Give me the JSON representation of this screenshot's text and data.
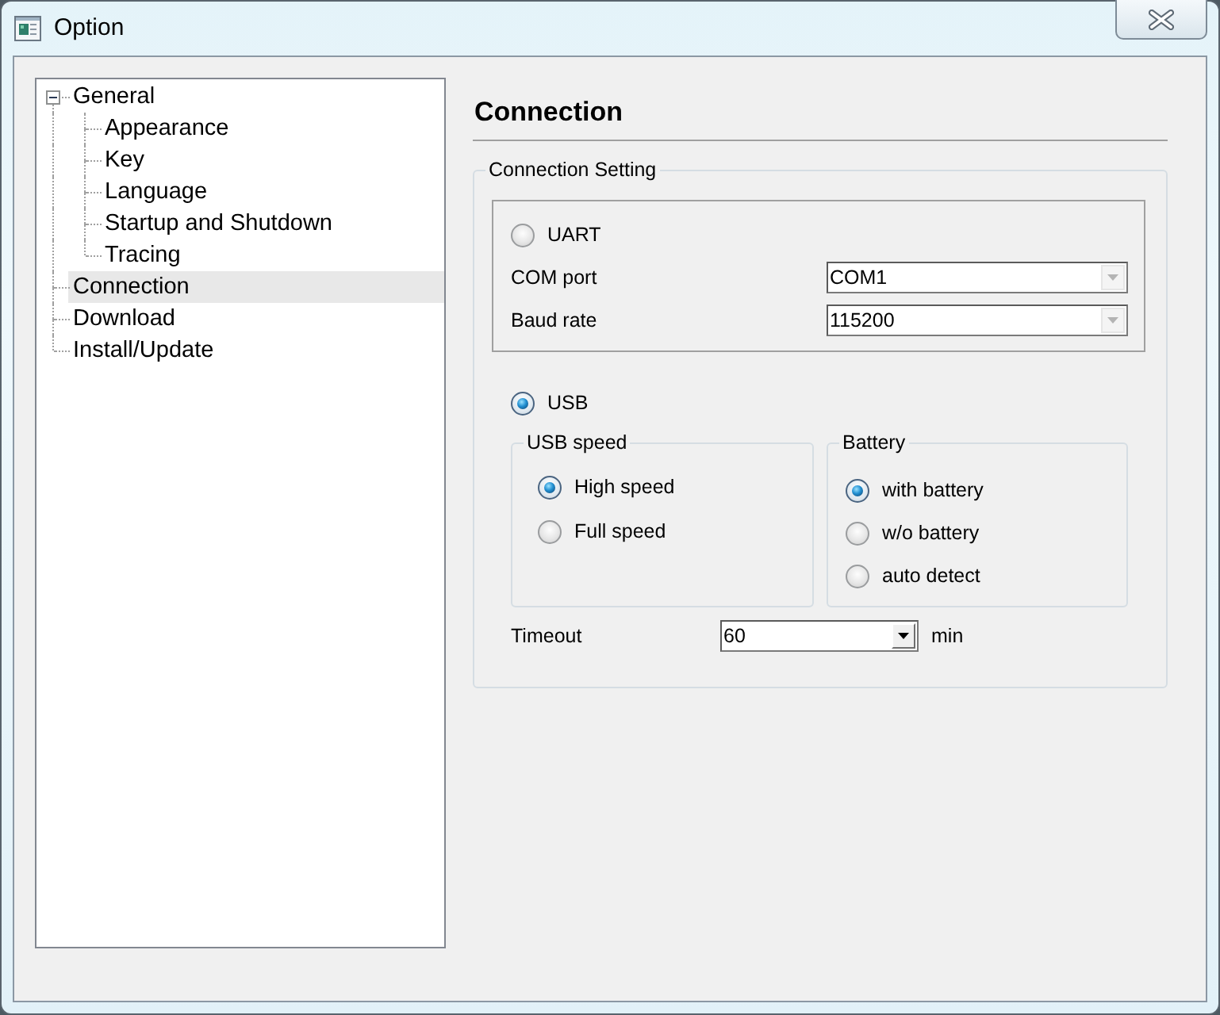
{
  "window": {
    "title": "Option"
  },
  "tree": [
    {
      "label": "General",
      "selected": false,
      "expanded": true,
      "children": [
        {
          "label": "Appearance",
          "selected": false
        },
        {
          "label": "Key",
          "selected": false
        },
        {
          "label": "Language",
          "selected": false
        },
        {
          "label": "Startup and Shutdown",
          "selected": false
        },
        {
          "label": "Tracing",
          "selected": false
        }
      ]
    },
    {
      "label": "Connection",
      "selected": true
    },
    {
      "label": "Download",
      "selected": false
    },
    {
      "label": "Install/Update",
      "selected": false
    }
  ],
  "page": {
    "title": "Connection"
  },
  "connection_setting": {
    "title": "Connection Setting",
    "uart": {
      "label": "UART",
      "selected": false,
      "com_port": {
        "label": "COM port",
        "value": "COM1",
        "disabled": true
      },
      "baud_rate": {
        "label": "Baud rate",
        "value": "115200",
        "disabled": true
      }
    },
    "usb": {
      "label": "USB",
      "selected": true,
      "usb_speed": {
        "title": "USB speed",
        "options": [
          {
            "label": "High speed",
            "selected": true
          },
          {
            "label": "Full speed",
            "selected": false
          }
        ]
      },
      "battery": {
        "title": "Battery",
        "options": [
          {
            "label": "with battery",
            "selected": true
          },
          {
            "label": "w/o battery",
            "selected": false
          },
          {
            "label": "auto detect",
            "selected": false
          }
        ]
      }
    },
    "timeout": {
      "label": "Timeout",
      "value": "60",
      "unit": "min",
      "disabled": false
    }
  }
}
